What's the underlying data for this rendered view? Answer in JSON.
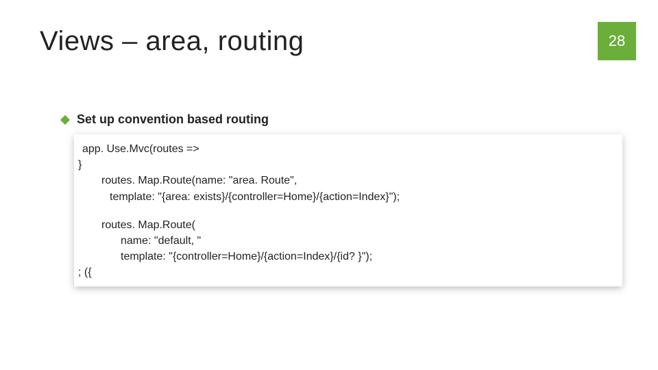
{
  "slide": {
    "title": "Views – area, routing",
    "page_number": "28",
    "bullet": "Set up convention based routing",
    "code": {
      "l1": "app. Use.Mvc(routes =>",
      "l2": "}",
      "l3": "routes. Map.Route(name: \"area. Route\",",
      "l4": "template: \"{area: exists}/{controller=Home}/{action=Index}\");",
      "l5": "routes. Map.Route(",
      "l6": "name: \"default, \"",
      "l7": "template: \"{controller=Home}/{action=Index}/{id? }\");",
      "l8": "; ({"
    }
  }
}
